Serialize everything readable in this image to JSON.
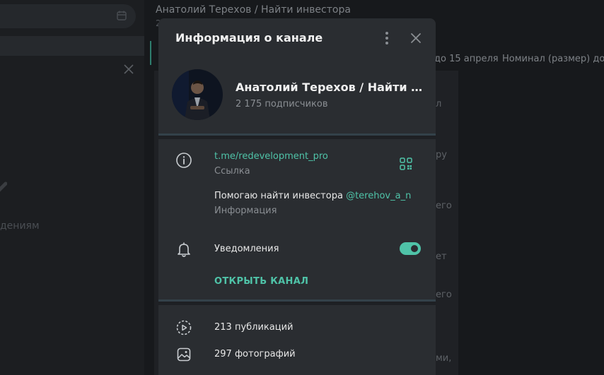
{
  "background": {
    "left_panel_text": "дениям",
    "chat_title": "Анатолий Терехов / Найти инвестора",
    "chat_subtitle": "2",
    "pinned_text_a": "до 15 апреля",
    "pinned_text_b": "Номинал (размер) долг",
    "fragments": [
      "л",
      "ру",
      "его",
      "ет",
      "его",
      "ми,"
    ]
  },
  "modal": {
    "title": "Информация о канале",
    "channel": {
      "name": "Анатолий Терехов / Найти инвестора",
      "subscribers": "2 175 подписчиков"
    },
    "link": {
      "value": "t.me/redevelopment_pro",
      "label": "Ссылка"
    },
    "about": {
      "text": "Помогаю найти инвестора ",
      "mention": "@terehov_a_n",
      "label": "Информация"
    },
    "notifications": {
      "label": "Уведомления",
      "enabled": true
    },
    "open_channel_label": "ОТКРЫТЬ КАНАЛ",
    "stats": [
      {
        "icon": "video-icon",
        "text": "213 публикаций"
      },
      {
        "icon": "photo-icon",
        "text": "297 фотографий"
      }
    ]
  },
  "colors": {
    "accent": "#4fc3a8",
    "modal_bg": "#2a2d31",
    "secondary_text": "#8a8e93"
  }
}
